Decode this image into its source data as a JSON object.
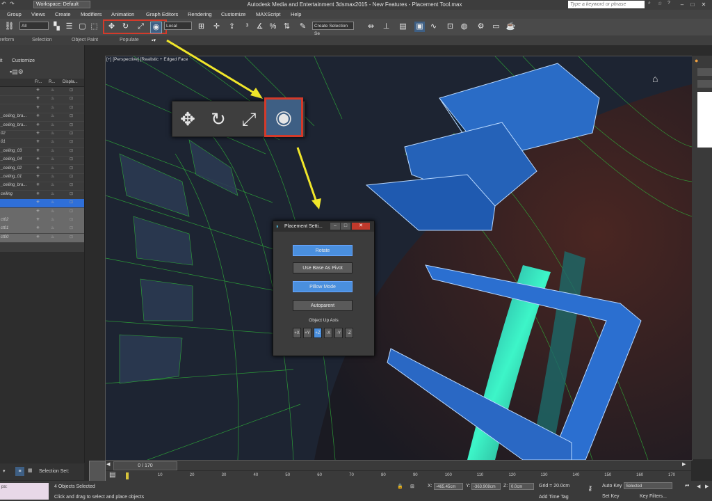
{
  "window": {
    "title": "Autodesk Media and Entertainment 3dsmax2015 - New Features - Placement Tool.max",
    "workspace": "Workspace: Default",
    "search_placeholder": "Type a keyword or phrase"
  },
  "menu": [
    "Group",
    "Views",
    "Create",
    "Modifiers",
    "Animation",
    "Graph Editors",
    "Rendering",
    "Customize",
    "MAXScript",
    "Help"
  ],
  "toolbar": {
    "filter_value": "All",
    "coord_value": "Local",
    "named_selection_value": "Create Selection Se"
  },
  "ribbon": [
    "reform",
    "Selection",
    "Object Paint",
    "Populate"
  ],
  "left_panel": {
    "menu": [
      "it",
      "Customize"
    ],
    "columns": [
      "Fr...",
      "R...",
      "Displa..."
    ],
    "rows": [
      {
        "name": ""
      },
      {
        "name": ""
      },
      {
        "name": ""
      },
      {
        "name": "_ceiling_bra..."
      },
      {
        "name": "_ceiling_bra..."
      },
      {
        "name": "02"
      },
      {
        "name": "01"
      },
      {
        "name": "_ceiling_03"
      },
      {
        "name": "_ceiling_04"
      },
      {
        "name": "_ceiling_02"
      },
      {
        "name": "_ceiling_01"
      },
      {
        "name": "_ceiling_bra..."
      },
      {
        "name": "ceiling"
      },
      {
        "name": ""
      },
      {
        "name": ""
      },
      {
        "name": "ct02"
      },
      {
        "name": "ct01"
      },
      {
        "name": "ct00"
      }
    ]
  },
  "viewport": {
    "label": "[+] [Perspective] [Realistic + Edged Face"
  },
  "dialog": {
    "title": "Placement Setti...",
    "buttons": {
      "rotate": "Rotate",
      "use_base": "Use Base As Pivot",
      "pillow": "Pillow Mode",
      "autoparent": "Autoparent"
    },
    "axis_label": "Object Up Axis",
    "axes": [
      "+X",
      "+Y",
      "+Z",
      "-X",
      "-Y",
      "-Z"
    ],
    "selected_axis": "+Z"
  },
  "timeline": {
    "frame": "0 / 170",
    "ticks": [
      "0",
      "10",
      "20",
      "30",
      "40",
      "50",
      "60",
      "70",
      "80",
      "90",
      "100",
      "110",
      "120",
      "130",
      "140",
      "150",
      "160",
      "170"
    ]
  },
  "status": {
    "selection_set": "Selection Set:",
    "selected": "4 Objects Selected",
    "prompt": "Click and drag to select and place objects",
    "x": "-465.45cm",
    "y": "-363.908cm",
    "z": "0.0cm",
    "grid": "Grid = 20.0cm",
    "autokey": "Auto Key",
    "autokey_mode": "Selected",
    "setkey": "Set Key",
    "keyfilters": "Key Filters...",
    "addtimetag": "Add Time Tag",
    "left_box": "ps:"
  },
  "colors": {
    "accent": "#4a8fde",
    "highlight": "#d33a2a",
    "arrow": "#f0e62a"
  }
}
